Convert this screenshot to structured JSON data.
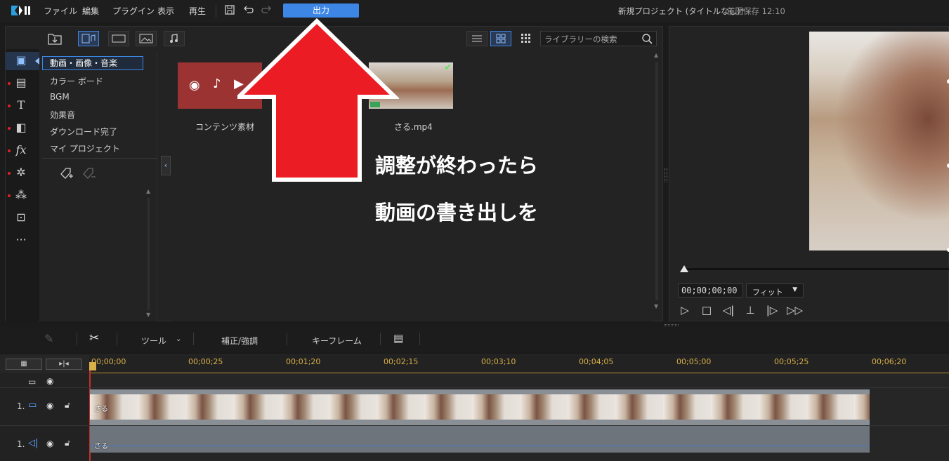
{
  "menu": {
    "items": [
      "ファイル",
      "編集",
      "プラグイン",
      "表示",
      "再生"
    ],
    "output_button": "出力",
    "project_title": "新規プロジェクト (タイトルなし)*",
    "last_saved": "前回保存 12:10"
  },
  "library": {
    "search_placeholder": "ライブラリーの検索",
    "categories": [
      "動画・画像・音楽",
      "カラー ボード",
      "BGM",
      "効果音",
      "ダウンロード完了",
      "マイ プロジェクト"
    ],
    "media": [
      {
        "label": "コンテンツ素材"
      },
      {
        "label": "さる.mp4"
      }
    ]
  },
  "overlay": {
    "line1": "調整が終わったら",
    "line2": "動画の書き出しを"
  },
  "preview": {
    "timecode": "00;00;00;00",
    "fit": "フィット"
  },
  "edit_toolbar": {
    "tools": "ツール",
    "correction": "補正/強調",
    "keyframe": "キーフレーム"
  },
  "timeline": {
    "ticks": [
      "00;00;00",
      "00;00;25",
      "00;01;20",
      "00;02;15",
      "00;03;10",
      "00;04;05",
      "00;05;00",
      "00;05;25",
      "00;06;20"
    ],
    "tracks": [
      {
        "number": "1.",
        "clip_label": "さる"
      },
      {
        "number": "1.",
        "clip_label": "さる"
      }
    ]
  },
  "colors": {
    "accent": "#3d86e6",
    "arrow": "#ec1c24",
    "ruler": "#d9b048"
  }
}
